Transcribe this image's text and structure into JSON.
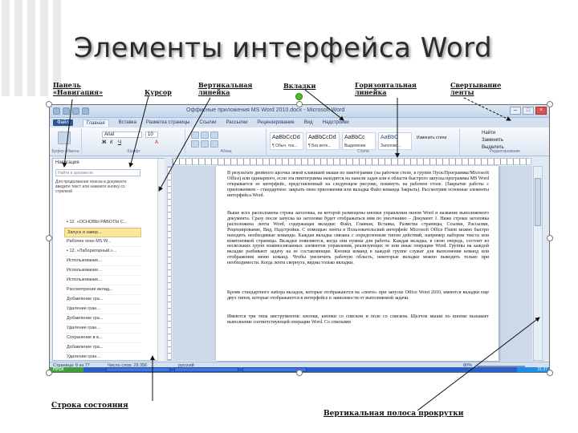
{
  "slide": {
    "title": "Элементы интерфейса Word"
  },
  "annotations": {
    "nav_pane_l1": "Панель",
    "nav_pane_l2": "«Навигация»",
    "cursor": "Курсор",
    "vruler_l1": "Вертикальная",
    "vruler_l2": "линейка",
    "tab": "Вкладки",
    "hruler_l1": "Горизонтальная",
    "hruler_l2": "линейка",
    "collapse_l1": "Свертывание",
    "collapse_l2": "ленты",
    "statusbar": "Строка состояния",
    "vscroll": "Вертикальная полоса прокрутки"
  },
  "window": {
    "title": "Оффисные приложения MS Word 2010.docx - Microsoft Word",
    "tabs": [
      "Файл",
      "Главная",
      "Вставка",
      "Разметка страницы",
      "Ссылки",
      "Рассылки",
      "Рецензирование",
      "Вид",
      "Надстройки"
    ],
    "ribbon": {
      "font_name": "Arial",
      "font_size": "10",
      "groups": [
        "Буфер обмена",
        "Шрифт",
        "Абзац",
        "Стили",
        "Редактирование"
      ],
      "styles": [
        {
          "sample": "AaBbCcDd",
          "name": "¶ Обыч. тек..."
        },
        {
          "sample": "AaBbCcDd",
          "name": "¶ Без инте..."
        },
        {
          "sample": "AaBbCc",
          "name": "Выделение"
        },
        {
          "sample": "AaBbC",
          "name": "Заголово..."
        }
      ],
      "editing": [
        "Найти",
        "Заменить",
        "Выделить"
      ],
      "change_styles": "Изменить стили"
    },
    "nav": {
      "header": "Навигация",
      "search_placeholder": "Найти в документе",
      "hint": "Для продолжения поиска в документе введите текст или нажмите кнопку со стрелкой",
      "items": [
        "▪ 12. «ОСНОВЫ РАБОТЫ С...",
        "Запуск и завер...",
        "Рабочее окно MS W...",
        "▪ 12. «Лабораторный.»...",
        "Использование...",
        "Использование...",
        "Использование...",
        "Рассмотрение вклад...",
        "Добавление гра...",
        "Удаление гран...",
        "Добавление гра...",
        "Удаление гран...",
        "Сохранение в в...",
        "Добавление гра...",
        "Удаление гран..."
      ]
    },
    "document_paragraphs": [
      "В результате двойного щелчка левой клавишей мыши по пиктограмме (на рабочем столе, в группе Пуск/Программы/Microsoft Office) или одинарного, если эта пиктограмма находится на панели задач или в области быстрого запуска программы MS Word открывается ее интерфейс, представленный на следующем рисунке, покинуть на рабочем столе. (Закрытие работы с приложением – стандартное: закрыть окно приложения или вкладка Файл команда Закрыть). Рассмотрим основные элементы интерфейса Word.",
      "Выше всех расположена строка заголовка, на которой размещены кнопки управления окном Word и название выполняемого документа. Сразу после запуска на заголовке будет отображаться имя по умолчанию – Документ 1. Ниже строки заголовка расположена лента Word, содержащая вкладки: Файл, Главная, Вставка, Разметка страницы, Ссылки, Рассылки, Рецензирование, Вид, Надстройки. С помощью ленты в Пользовательский интерфейс Microsoft Office Fluent можно быстро находить необходимые команды. Каждая вкладка связана с определенным типом действий, например набором текста или компоновкой страницы. Вкладки появляются, когда они нужны для работы. Каждая вкладка, в свою очередь, состоит из нескольких групп взаимосвязанных элементов управления, реализующих те или иные операции Word. Группы на каждой вкладке разбивают задачу на ее составляющие. Кнопки команд в каждой группе служат для выполнения команд или отображения меню команд. Чтобы увеличить рабочую область, некоторые вкладки можно выводить только при необходимости. Когда лента свернута, видны только вкладки.",
      "Кроме стандартного набора вкладок, которые отображаются на «ленте» при запуске Office Word 2010, имеются вкладки еще двух типов, которые отображаются в интерфейсе в зависимости от выполняемой задачи.",
      "Имеются три типа инструментов: кнопки, кнопки со списком и поле со списком. Щелчок мыши по кнопке вызывает выполнение соответствующей операции Word. Со списками"
    ],
    "status": {
      "page": "Страница: 8 из 77",
      "words": "Число слов: 28 356",
      "lang": "русский",
      "zoom": "80%"
    },
    "taskbar": {
      "start": "ПУСК",
      "buttons": [
        "F:\\ПРОФ\\...",
        "Оффисные прилож...",
        "Документ 1"
      ],
      "clock": "21:37"
    }
  }
}
